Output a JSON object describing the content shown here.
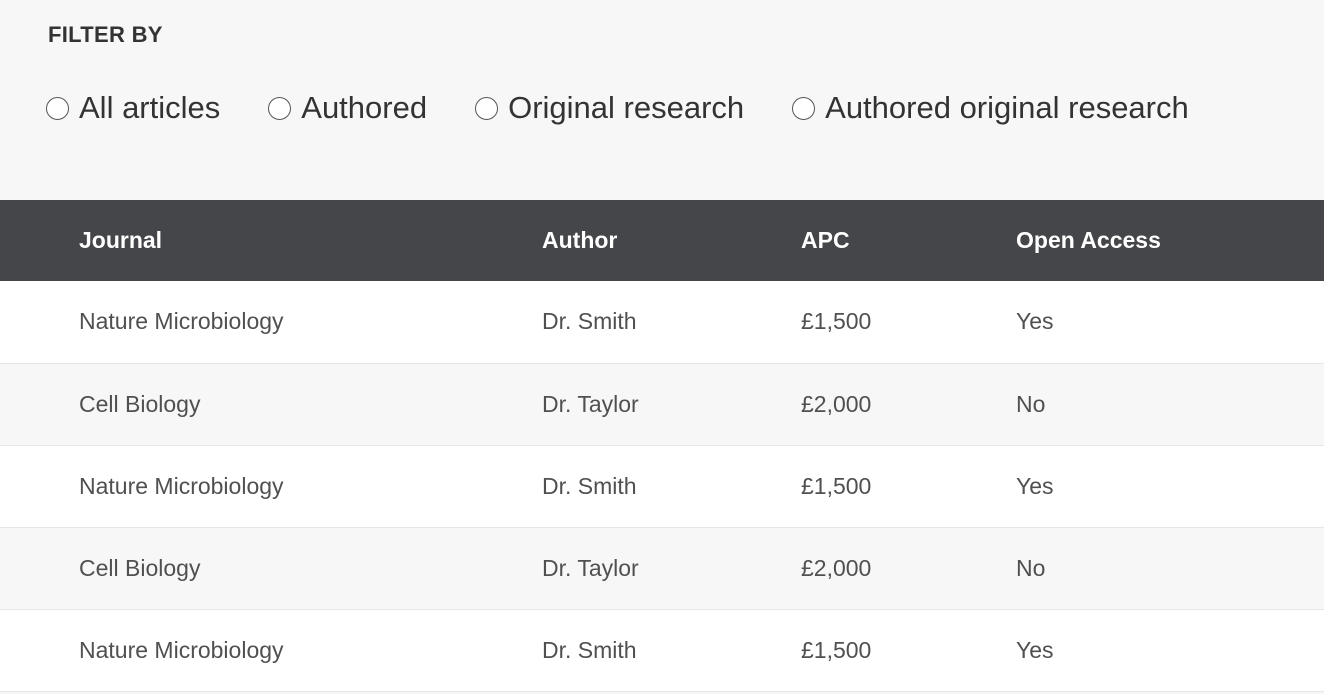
{
  "filter": {
    "title": "FILTER BY",
    "options": [
      {
        "label": "All articles",
        "selected": false
      },
      {
        "label": "Authored",
        "selected": false
      },
      {
        "label": "Original research",
        "selected": false
      },
      {
        "label": "Authored original research",
        "selected": false
      }
    ]
  },
  "table": {
    "headers": {
      "journal": "Journal",
      "author": "Author",
      "apc": "APC",
      "open_access": "Open Access"
    },
    "rows": [
      {
        "journal": "Nature Microbiology",
        "author": "Dr. Smith",
        "apc": "£1,500",
        "open_access": "Yes"
      },
      {
        "journal": "Cell Biology",
        "author": "Dr. Taylor",
        "apc": "£2,000",
        "open_access": "No"
      },
      {
        "journal": "Nature Microbiology",
        "author": "Dr. Smith",
        "apc": "£1,500",
        "open_access": "Yes"
      },
      {
        "journal": "Cell Biology",
        "author": "Dr. Taylor",
        "apc": "£2,000",
        "open_access": "No"
      },
      {
        "journal": "Nature Microbiology",
        "author": "Dr. Smith",
        "apc": "£1,500",
        "open_access": "Yes"
      }
    ]
  },
  "colors": {
    "header_background": "#454649",
    "header_text": "#ffffff",
    "row_odd": "#ffffff",
    "row_even": "#f7f7f7",
    "page_background": "#f7f7f7"
  }
}
